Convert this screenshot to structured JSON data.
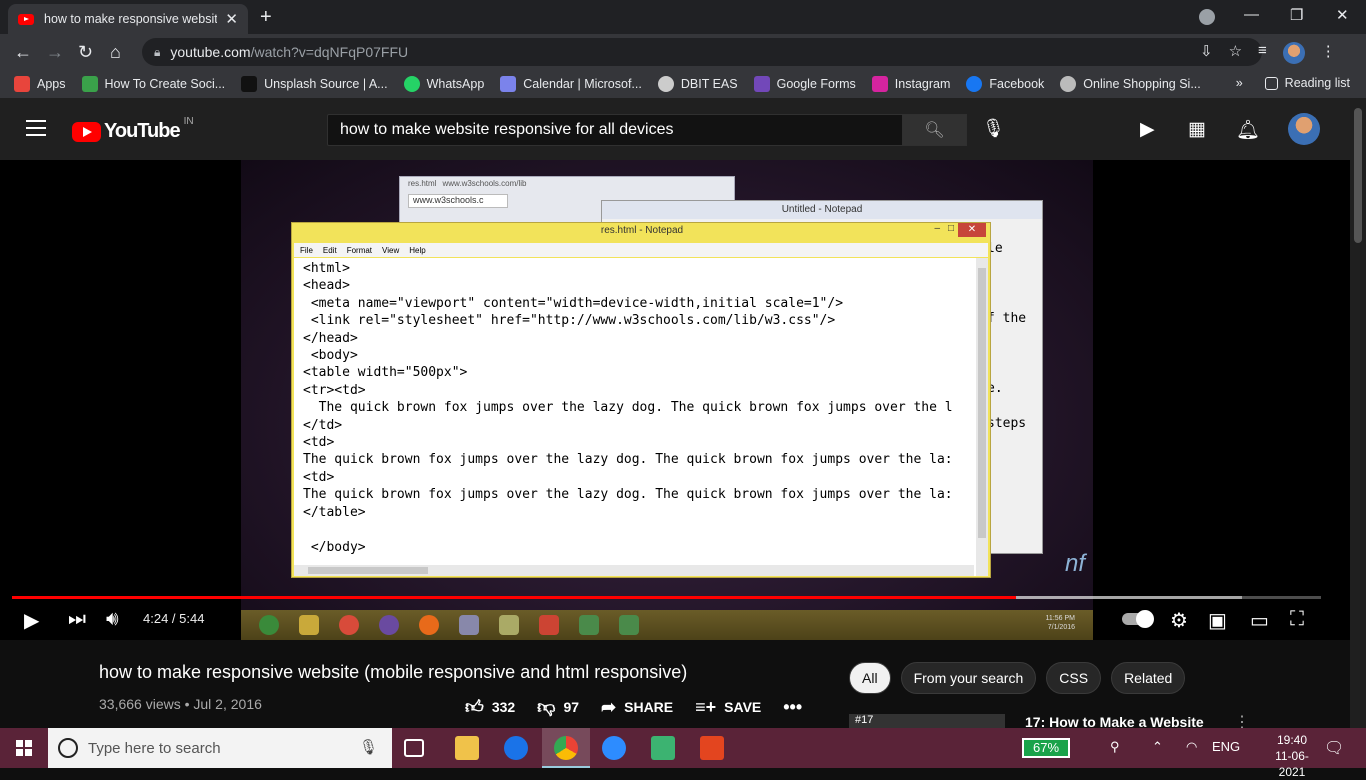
{
  "browser": {
    "tab_title": "how to make responsive website",
    "address_host": "youtube.com",
    "address_path": "/watch?v=dqNFqP07FFU",
    "bookmarks": [
      {
        "label": "Apps",
        "color": "#e8453c"
      },
      {
        "label": "How To Create Soci...",
        "color": "#3aa14a"
      },
      {
        "label": "Unsplash Source | A...",
        "color": "#222222"
      },
      {
        "label": "WhatsApp",
        "color": "#25d366"
      },
      {
        "label": "Calendar | Microsof...",
        "color": "#7b83eb"
      },
      {
        "label": "DBIT EAS",
        "color": "#cccccc"
      },
      {
        "label": "Google Forms",
        "color": "#7248b9"
      },
      {
        "label": "Instagram",
        "color": "#d6249f"
      },
      {
        "label": "Facebook",
        "color": "#1877f2"
      },
      {
        "label": "Online Shopping Si...",
        "color": "#bbbbbb"
      }
    ],
    "overflow": "»",
    "reading_list": "Reading list"
  },
  "youtube": {
    "logo_text": "YouTube",
    "country_code": "IN",
    "search_query": "how to make website responsive for all devices"
  },
  "video_frame": {
    "chrome_tabs": [
      "res.html",
      "www.w3schools.com/lib"
    ],
    "chrome_address": "www.w3schools.c",
    "notepad2_title": "Untitled - Notepad",
    "notepad2_text": "le\n\nf the\n\ne.\nsteps",
    "notepad_title": "res.html - Notepad",
    "notepad_menu": [
      "File",
      "Edit",
      "Format",
      "View",
      "Help"
    ],
    "code": "<html>\n<head>\n <meta name=\"viewport\" content=\"width=device-width,initial scale=1\"/>\n <link rel=\"stylesheet\" href=\"http://www.w3schools.com/lib/w3.css\"/>\n</head>\n <body>\n<table width=\"500px\">\n<tr><td>\n  The quick brown fox jumps over the lazy dog. The quick brown fox jumps over the l\n</td>\n<td>\nThe quick brown fox jumps over the lazy dog. The quick brown fox jumps over the la:\n<td>\nThe quick brown fox jumps over the lazy dog. The quick brown fox jumps over the la:\n</table>\n\n </body>",
    "watermark": "nf",
    "taskbar_time": "11:56 PM",
    "taskbar_date": "7/1/2016"
  },
  "player": {
    "time_current": "4:24",
    "time_total": "5:44",
    "time_display": "4:24 / 5:44",
    "progress_fraction": 0.767,
    "buffered_fraction": 0.94
  },
  "video_info": {
    "title": "how to make responsive website (mobile responsive and html responsive)",
    "views": "33,666 views",
    "date": "Jul 2, 2016",
    "meta": "33,666 views • Jul 2, 2016",
    "likes": "332",
    "dislikes": "97",
    "share_label": "SHARE",
    "save_label": "SAVE"
  },
  "chips": [
    "All",
    "From your search",
    "CSS",
    "Related"
  ],
  "recommendation": {
    "badge": "#17",
    "title": "17: How to Make a Website"
  },
  "taskbar": {
    "search_placeholder": "Type here to search",
    "battery": "67%",
    "language": "ENG",
    "time": "19:40",
    "date": "11-06-2021"
  }
}
